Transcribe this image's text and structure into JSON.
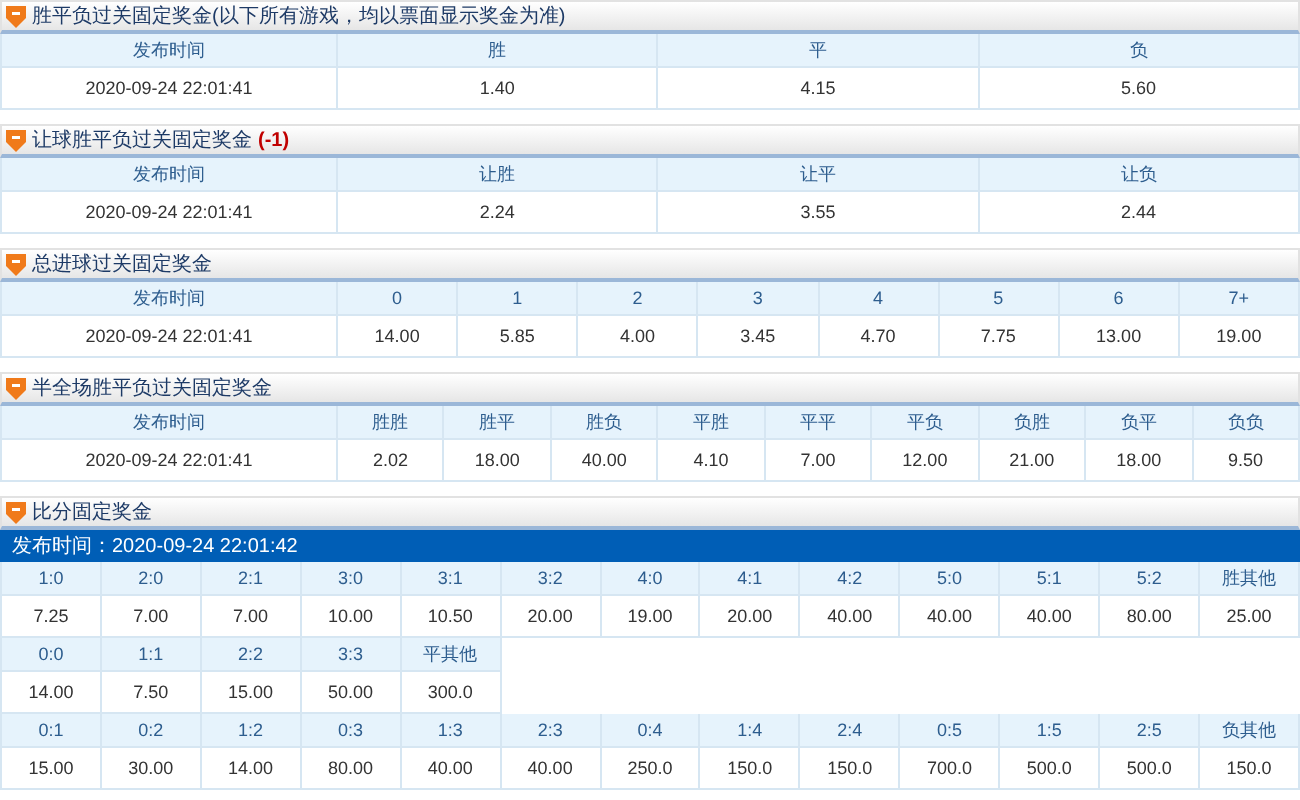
{
  "sections": [
    {
      "kind": "table",
      "title": "胜平负过关固定奖金(以下所有游戏，均以票面显示奖金为准)",
      "columns": [
        "发布时间",
        "胜",
        "平",
        "负"
      ],
      "row": [
        "2020-09-24 22:01:41",
        "1.40",
        "4.15",
        "5.60"
      ]
    },
    {
      "kind": "table",
      "title": "让球胜平负过关固定奖金",
      "handicap": "(-1)",
      "columns": [
        "发布时间",
        "让胜",
        "让平",
        "让负"
      ],
      "row": [
        "2020-09-24 22:01:41",
        "2.24",
        "3.55",
        "2.44"
      ]
    },
    {
      "kind": "table",
      "title": "总进球过关固定奖金",
      "columns": [
        "发布时间",
        "0",
        "1",
        "2",
        "3",
        "4",
        "5",
        "6",
        "7+"
      ],
      "row": [
        "2020-09-24 22:01:41",
        "14.00",
        "5.85",
        "4.00",
        "3.45",
        "4.70",
        "7.75",
        "13.00",
        "19.00"
      ]
    },
    {
      "kind": "table",
      "title": "半全场胜平负过关固定奖金",
      "columns": [
        "发布时间",
        "胜胜",
        "胜平",
        "胜负",
        "平胜",
        "平平",
        "平负",
        "负胜",
        "负平",
        "负负"
      ],
      "row": [
        "2020-09-24 22:01:41",
        "2.02",
        "18.00",
        "40.00",
        "4.10",
        "7.00",
        "12.00",
        "21.00",
        "18.00",
        "9.50"
      ]
    },
    {
      "kind": "score",
      "title": "比分固定奖金",
      "published": "发布时间：2020-09-24 22:01:42",
      "groups": [
        {
          "labels": [
            "1:0",
            "2:0",
            "2:1",
            "3:0",
            "3:1",
            "3:2",
            "4:0",
            "4:1",
            "4:2",
            "5:0",
            "5:1",
            "5:2",
            "胜其他"
          ],
          "values": [
            "7.25",
            "7.00",
            "7.00",
            "10.00",
            "10.50",
            "20.00",
            "19.00",
            "20.00",
            "40.00",
            "40.00",
            "40.00",
            "80.00",
            "25.00"
          ]
        },
        {
          "labels": [
            "0:0",
            "1:1",
            "2:2",
            "3:3",
            "平其他"
          ],
          "values": [
            "14.00",
            "7.50",
            "15.00",
            "50.00",
            "300.0"
          ]
        },
        {
          "labels": [
            "0:1",
            "0:2",
            "1:2",
            "0:3",
            "1:3",
            "2:3",
            "0:4",
            "1:4",
            "2:4",
            "0:5",
            "1:5",
            "2:5",
            "负其他"
          ],
          "values": [
            "15.00",
            "30.00",
            "14.00",
            "80.00",
            "40.00",
            "40.00",
            "250.0",
            "150.0",
            "150.0",
            "700.0",
            "500.0",
            "500.0",
            "150.0"
          ]
        }
      ]
    }
  ]
}
